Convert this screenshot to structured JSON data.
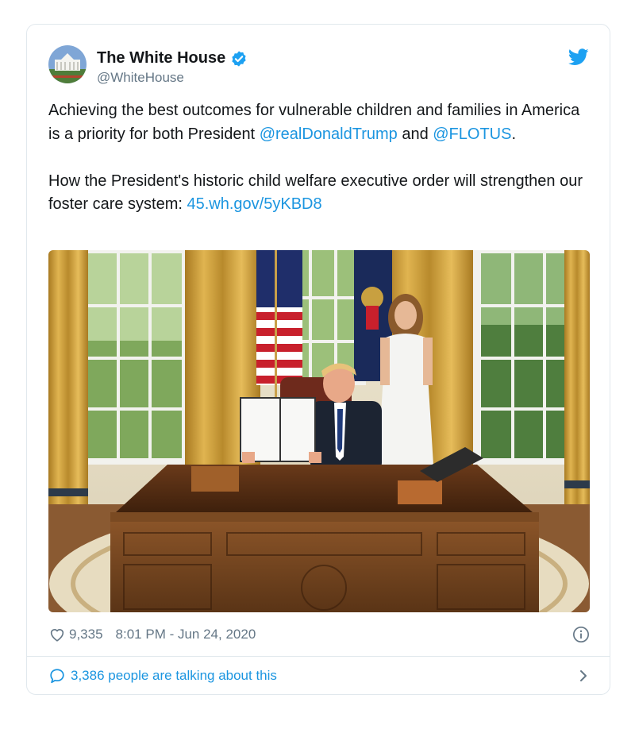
{
  "account": {
    "display_name": "The White House",
    "handle": "@WhiteHouse",
    "verified": true
  },
  "tweet": {
    "p1_a": "Achieving the best outcomes for vulnerable children and families in America is a priority for both President ",
    "mention1": "@realDonaldTrump",
    "p1_b": " and ",
    "mention2": "@FLOTUS",
    "p1_c": ".",
    "p2_a": "How the President's historic child welfare executive order will strengthen our foster care system: ",
    "link": "45.wh.gov/5yKBD8"
  },
  "meta": {
    "likes": "9,335",
    "timestamp": "8:01 PM - Jun 24, 2020"
  },
  "footer": {
    "talking": "3,386 people are talking about this"
  },
  "icons": {
    "bird": "twitter-bird-icon",
    "verified": "verified-badge-icon",
    "like": "heart-icon",
    "info": "info-icon",
    "reply": "speech-bubble-icon",
    "chevron": "chevron-right-icon"
  },
  "colors": {
    "link": "#1b95e0",
    "secondary_text": "#657786",
    "border": "#e1e8ed",
    "verified": "#1da1f2"
  }
}
